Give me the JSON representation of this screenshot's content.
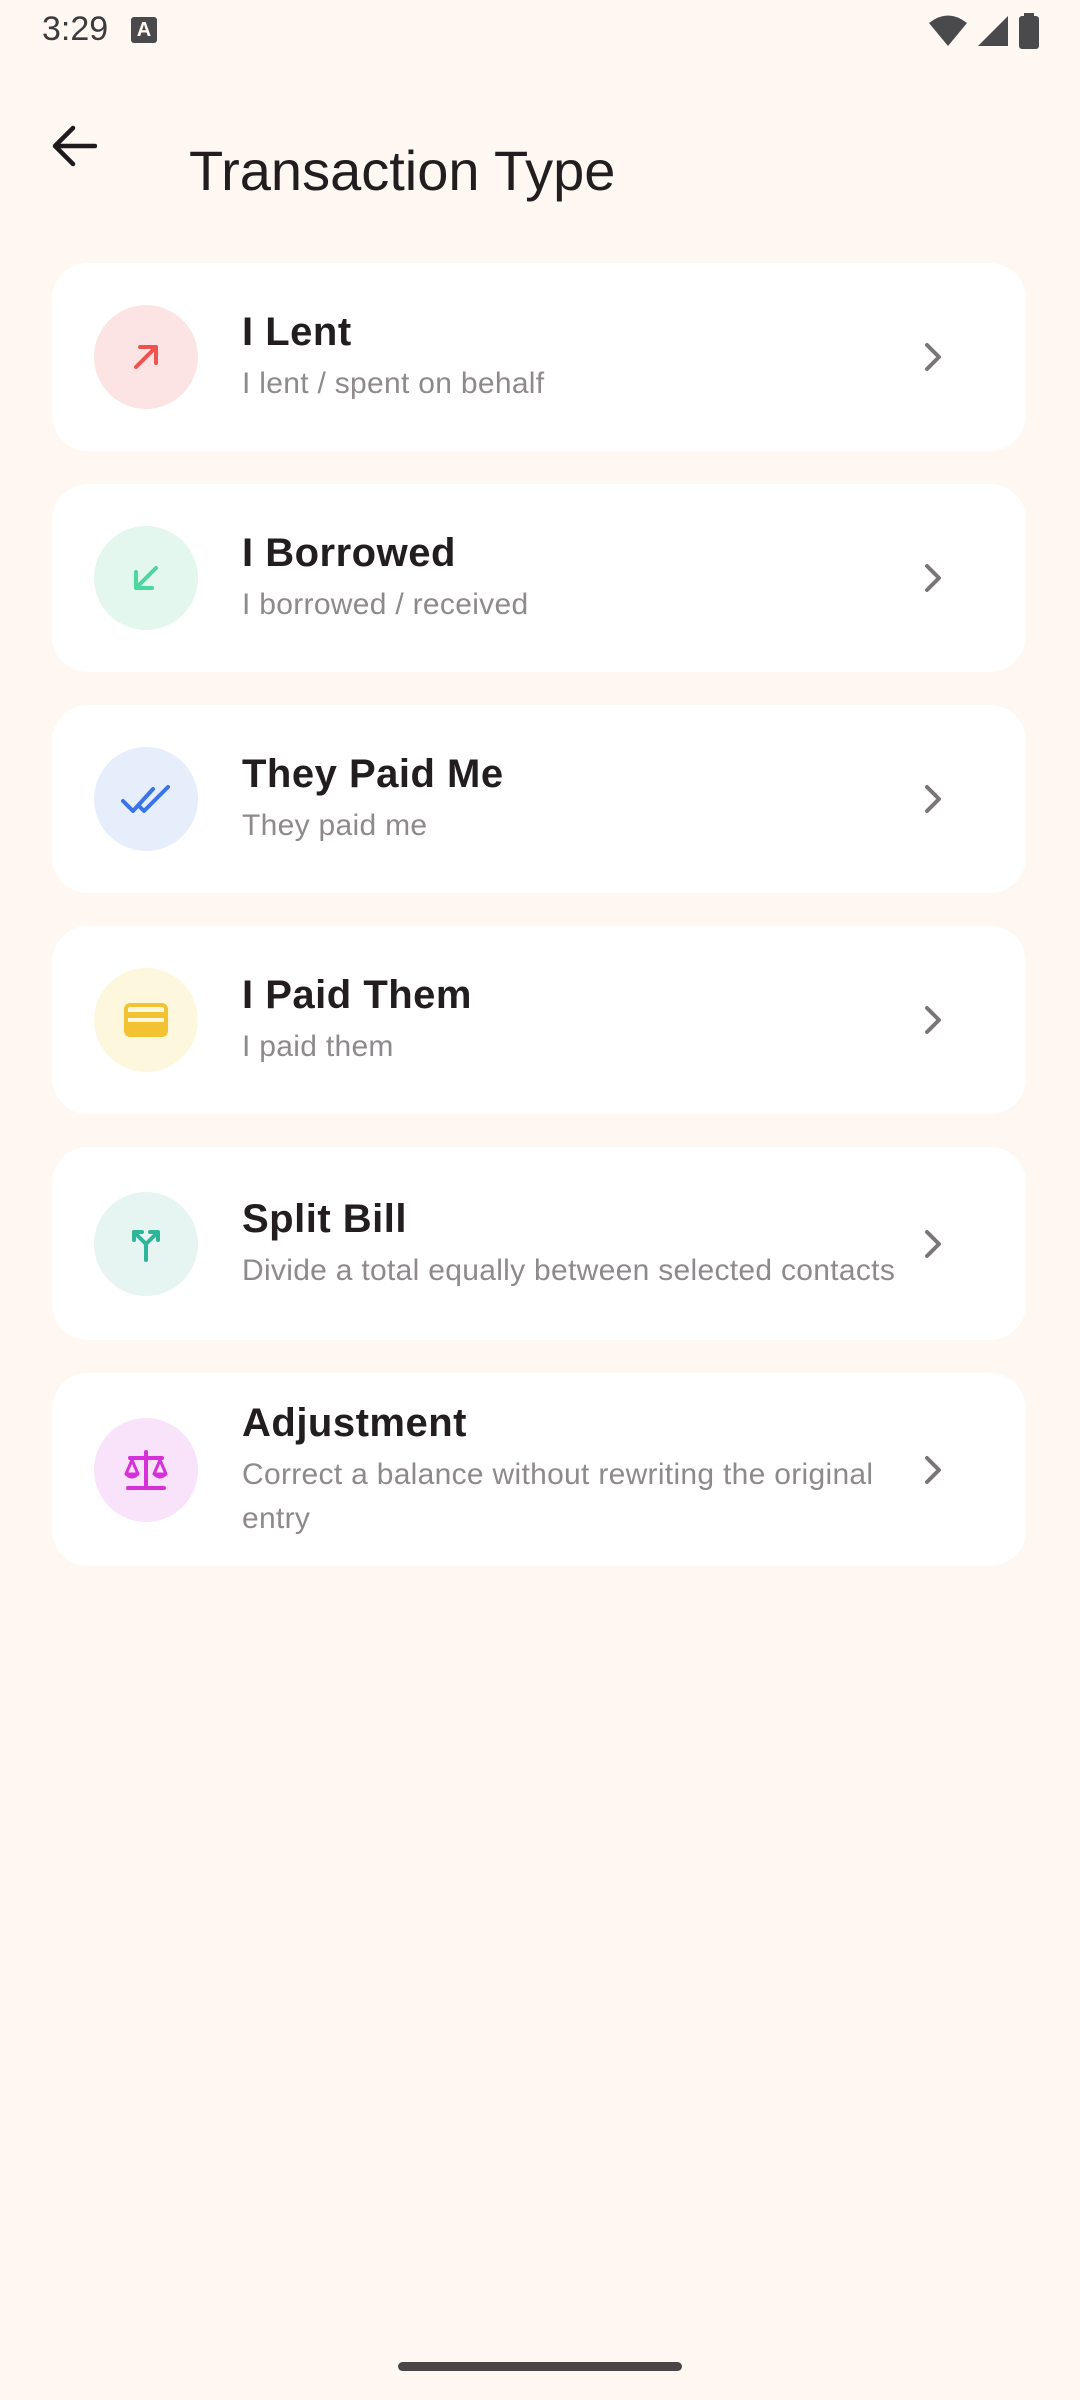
{
  "status": {
    "time": "3:29",
    "badge": "A"
  },
  "header": {
    "title": "Transaction Type"
  },
  "items": [
    {
      "title": "I Lent",
      "subtitle": "I lent / spent on behalf",
      "icon": "arrow-up-right-icon",
      "color": "#ef5350",
      "bg": "#fde4e4"
    },
    {
      "title": "I Borrowed",
      "subtitle": "I borrowed / received",
      "icon": "arrow-down-left-icon",
      "color": "#4cd6a0",
      "bg": "#e3f7ee"
    },
    {
      "title": "They Paid Me",
      "subtitle": "They paid me",
      "icon": "double-check-icon",
      "color": "#3b73e8",
      "bg": "#e6eefc"
    },
    {
      "title": "I Paid Them",
      "subtitle": "I paid them",
      "icon": "credit-card-icon",
      "color": "#f3c233",
      "bg": "#fdf7de"
    },
    {
      "title": "Split Bill",
      "subtitle": "Divide a total equally between selected contacts",
      "icon": "split-arrow-icon",
      "color": "#2eb59a",
      "bg": "#e6f5f1"
    },
    {
      "title": "Adjustment",
      "subtitle": "Correct a balance without rewriting the original entry",
      "icon": "scale-balance-icon",
      "color": "#d630d8",
      "bg": "#f9e3fa"
    }
  ]
}
